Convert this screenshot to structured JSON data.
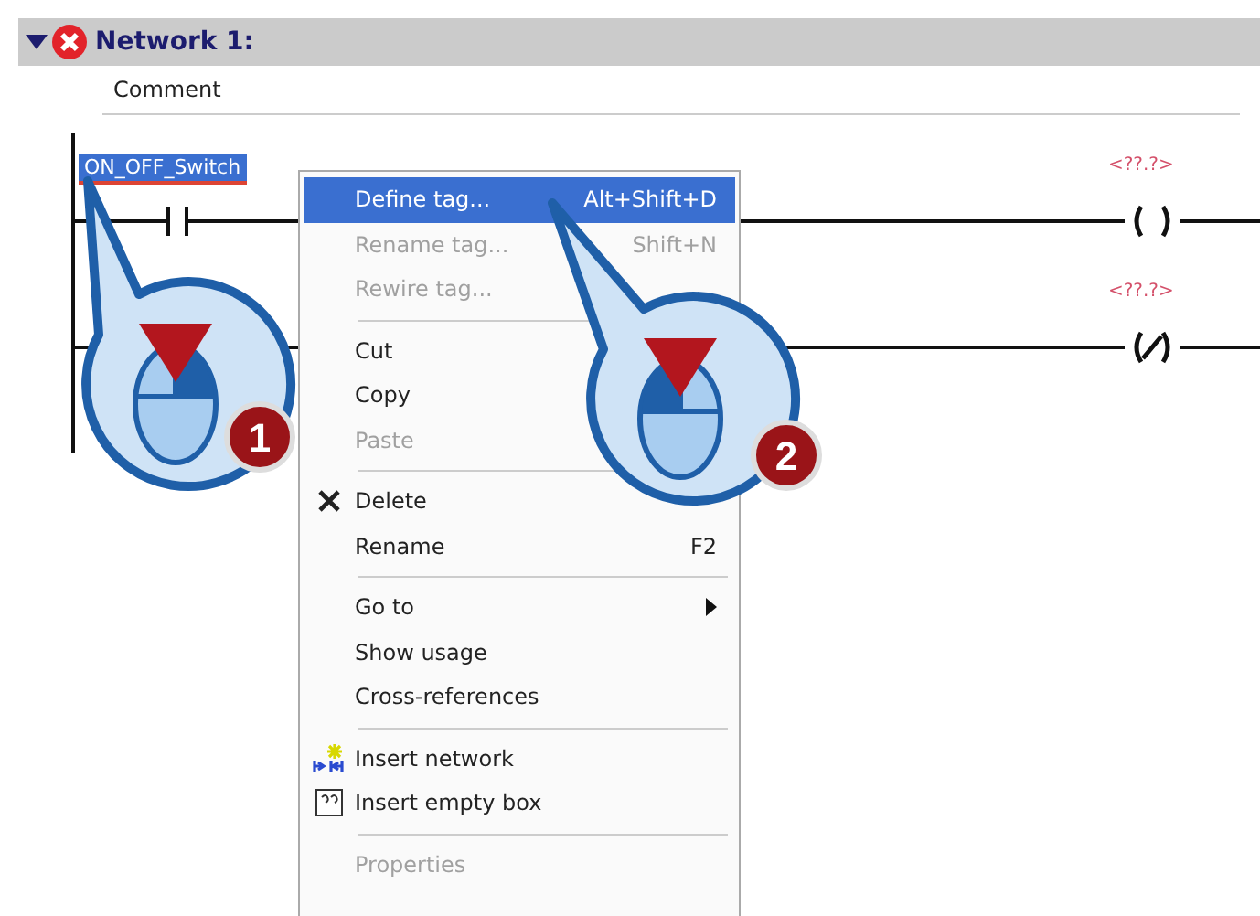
{
  "network": {
    "title": "Network 1:",
    "expanded": true,
    "error": true,
    "comment": "Comment"
  },
  "ladder": {
    "tag": "ON_OFF_Switch",
    "tag_selected": true,
    "coil_labels": [
      "<??.?>",
      "<??.?>"
    ]
  },
  "context_menu": {
    "items": [
      {
        "kind": "item",
        "label": "Define tag...",
        "shortcut": "Alt+Shift+D",
        "selected": true,
        "disabled": false
      },
      {
        "kind": "item",
        "label": "Rename tag...",
        "shortcut": "Shift+N",
        "selected": false,
        "disabled": true
      },
      {
        "kind": "item",
        "label": "Rewire tag...",
        "selected": false,
        "disabled": true
      },
      {
        "kind": "separator"
      },
      {
        "kind": "item",
        "label": "Cut",
        "selected": false,
        "disabled": false
      },
      {
        "kind": "item",
        "label": "Copy",
        "selected": false,
        "disabled": false
      },
      {
        "kind": "item",
        "label": "Paste",
        "selected": false,
        "disabled": true
      },
      {
        "kind": "separator"
      },
      {
        "kind": "item",
        "label": "Delete",
        "selected": false,
        "disabled": false
      },
      {
        "kind": "item",
        "label": "Rename",
        "shortcut": "F2",
        "selected": false,
        "disabled": false
      },
      {
        "kind": "separator"
      },
      {
        "kind": "submenu",
        "label": "Go to",
        "selected": false,
        "disabled": false
      },
      {
        "kind": "item",
        "label": "Show usage",
        "selected": false,
        "disabled": false
      },
      {
        "kind": "item",
        "label": "Cross-references",
        "selected": false,
        "disabled": false
      },
      {
        "kind": "separator"
      },
      {
        "kind": "item",
        "label": "Insert network",
        "selected": false,
        "disabled": false
      },
      {
        "kind": "item",
        "label": "Insert empty box",
        "selected": false,
        "disabled": false
      },
      {
        "kind": "separator"
      },
      {
        "kind": "item",
        "label": "Properties",
        "selected": false,
        "disabled": true
      }
    ]
  },
  "callouts": [
    {
      "number": "1"
    },
    {
      "number": "2"
    }
  ]
}
